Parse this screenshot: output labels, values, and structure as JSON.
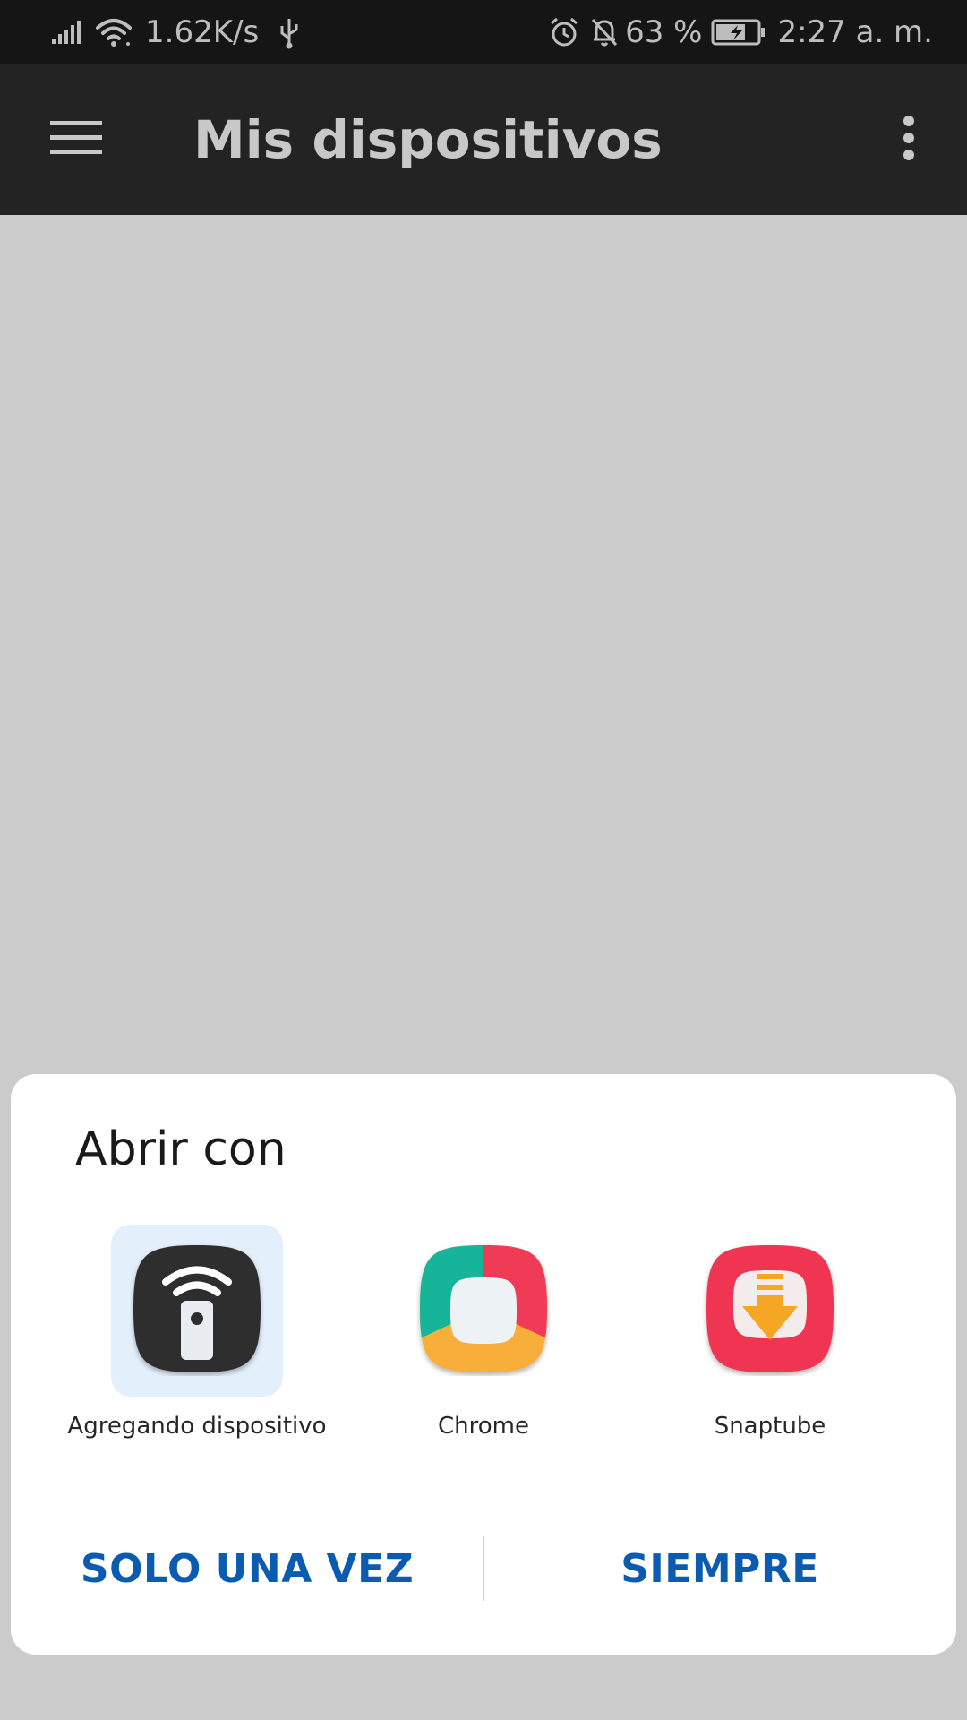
{
  "status_bar": {
    "net_speed": "1.62K/s",
    "battery_percent": "63 %",
    "time": "2:27 a. m.",
    "icons": [
      "signal-icon",
      "wifi-icon",
      "usb-icon",
      "alarm-icon",
      "bell-off-icon",
      "battery-charging-icon"
    ]
  },
  "app_bar": {
    "title": "Mis dispositivos",
    "menu_icon": "hamburger-menu-icon",
    "overflow_icon": "more-vert-icon"
  },
  "dialog": {
    "title": "Abrir con",
    "apps": [
      {
        "label": "Agregando dispositivo",
        "icon": "remote-wifi-app-icon",
        "selected": true
      },
      {
        "label": "Chrome",
        "icon": "chrome-app-icon",
        "selected": false
      },
      {
        "label": "Snaptube",
        "icon": "snaptube-app-icon",
        "selected": false
      }
    ],
    "buttons": {
      "once": "SOLO UNA VEZ",
      "always": "SIEMPRE"
    }
  },
  "colors": {
    "status_bar_bg": "#151515",
    "app_bar_bg": "#232323",
    "scrim": "#cbcbcb",
    "accent": "#0b5bb0",
    "selected_bg": "#e3f0fc",
    "chrome_green": "#18b59a",
    "chrome_red": "#ef3b57",
    "chrome_yellow": "#f7ae3a",
    "snaptube_red": "#ef3651",
    "snaptube_orange": "#f5a623"
  }
}
